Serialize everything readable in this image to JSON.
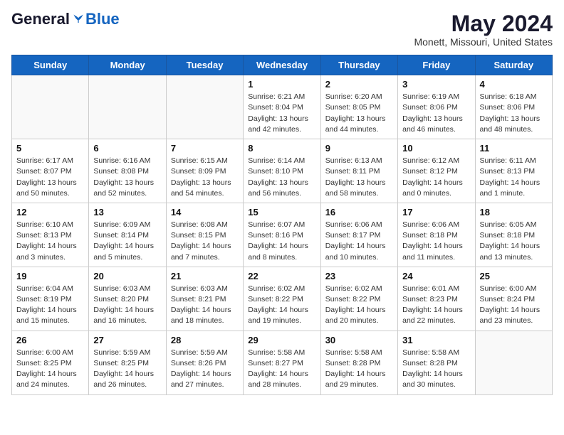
{
  "header": {
    "logo_general": "General",
    "logo_blue": "Blue",
    "month_year": "May 2024",
    "location": "Monett, Missouri, United States"
  },
  "days_of_week": [
    "Sunday",
    "Monday",
    "Tuesday",
    "Wednesday",
    "Thursday",
    "Friday",
    "Saturday"
  ],
  "weeks": [
    [
      {
        "day": "",
        "info": ""
      },
      {
        "day": "",
        "info": ""
      },
      {
        "day": "",
        "info": ""
      },
      {
        "day": "1",
        "info": "Sunrise: 6:21 AM\nSunset: 8:04 PM\nDaylight: 13 hours\nand 42 minutes."
      },
      {
        "day": "2",
        "info": "Sunrise: 6:20 AM\nSunset: 8:05 PM\nDaylight: 13 hours\nand 44 minutes."
      },
      {
        "day": "3",
        "info": "Sunrise: 6:19 AM\nSunset: 8:06 PM\nDaylight: 13 hours\nand 46 minutes."
      },
      {
        "day": "4",
        "info": "Sunrise: 6:18 AM\nSunset: 8:06 PM\nDaylight: 13 hours\nand 48 minutes."
      }
    ],
    [
      {
        "day": "5",
        "info": "Sunrise: 6:17 AM\nSunset: 8:07 PM\nDaylight: 13 hours\nand 50 minutes."
      },
      {
        "day": "6",
        "info": "Sunrise: 6:16 AM\nSunset: 8:08 PM\nDaylight: 13 hours\nand 52 minutes."
      },
      {
        "day": "7",
        "info": "Sunrise: 6:15 AM\nSunset: 8:09 PM\nDaylight: 13 hours\nand 54 minutes."
      },
      {
        "day": "8",
        "info": "Sunrise: 6:14 AM\nSunset: 8:10 PM\nDaylight: 13 hours\nand 56 minutes."
      },
      {
        "day": "9",
        "info": "Sunrise: 6:13 AM\nSunset: 8:11 PM\nDaylight: 13 hours\nand 58 minutes."
      },
      {
        "day": "10",
        "info": "Sunrise: 6:12 AM\nSunset: 8:12 PM\nDaylight: 14 hours\nand 0 minutes."
      },
      {
        "day": "11",
        "info": "Sunrise: 6:11 AM\nSunset: 8:13 PM\nDaylight: 14 hours\nand 1 minute."
      }
    ],
    [
      {
        "day": "12",
        "info": "Sunrise: 6:10 AM\nSunset: 8:13 PM\nDaylight: 14 hours\nand 3 minutes."
      },
      {
        "day": "13",
        "info": "Sunrise: 6:09 AM\nSunset: 8:14 PM\nDaylight: 14 hours\nand 5 minutes."
      },
      {
        "day": "14",
        "info": "Sunrise: 6:08 AM\nSunset: 8:15 PM\nDaylight: 14 hours\nand 7 minutes."
      },
      {
        "day": "15",
        "info": "Sunrise: 6:07 AM\nSunset: 8:16 PM\nDaylight: 14 hours\nand 8 minutes."
      },
      {
        "day": "16",
        "info": "Sunrise: 6:06 AM\nSunset: 8:17 PM\nDaylight: 14 hours\nand 10 minutes."
      },
      {
        "day": "17",
        "info": "Sunrise: 6:06 AM\nSunset: 8:18 PM\nDaylight: 14 hours\nand 11 minutes."
      },
      {
        "day": "18",
        "info": "Sunrise: 6:05 AM\nSunset: 8:18 PM\nDaylight: 14 hours\nand 13 minutes."
      }
    ],
    [
      {
        "day": "19",
        "info": "Sunrise: 6:04 AM\nSunset: 8:19 PM\nDaylight: 14 hours\nand 15 minutes."
      },
      {
        "day": "20",
        "info": "Sunrise: 6:03 AM\nSunset: 8:20 PM\nDaylight: 14 hours\nand 16 minutes."
      },
      {
        "day": "21",
        "info": "Sunrise: 6:03 AM\nSunset: 8:21 PM\nDaylight: 14 hours\nand 18 minutes."
      },
      {
        "day": "22",
        "info": "Sunrise: 6:02 AM\nSunset: 8:22 PM\nDaylight: 14 hours\nand 19 minutes."
      },
      {
        "day": "23",
        "info": "Sunrise: 6:02 AM\nSunset: 8:22 PM\nDaylight: 14 hours\nand 20 minutes."
      },
      {
        "day": "24",
        "info": "Sunrise: 6:01 AM\nSunset: 8:23 PM\nDaylight: 14 hours\nand 22 minutes."
      },
      {
        "day": "25",
        "info": "Sunrise: 6:00 AM\nSunset: 8:24 PM\nDaylight: 14 hours\nand 23 minutes."
      }
    ],
    [
      {
        "day": "26",
        "info": "Sunrise: 6:00 AM\nSunset: 8:25 PM\nDaylight: 14 hours\nand 24 minutes."
      },
      {
        "day": "27",
        "info": "Sunrise: 5:59 AM\nSunset: 8:25 PM\nDaylight: 14 hours\nand 26 minutes."
      },
      {
        "day": "28",
        "info": "Sunrise: 5:59 AM\nSunset: 8:26 PM\nDaylight: 14 hours\nand 27 minutes."
      },
      {
        "day": "29",
        "info": "Sunrise: 5:58 AM\nSunset: 8:27 PM\nDaylight: 14 hours\nand 28 minutes."
      },
      {
        "day": "30",
        "info": "Sunrise: 5:58 AM\nSunset: 8:28 PM\nDaylight: 14 hours\nand 29 minutes."
      },
      {
        "day": "31",
        "info": "Sunrise: 5:58 AM\nSunset: 8:28 PM\nDaylight: 14 hours\nand 30 minutes."
      },
      {
        "day": "",
        "info": ""
      }
    ]
  ]
}
